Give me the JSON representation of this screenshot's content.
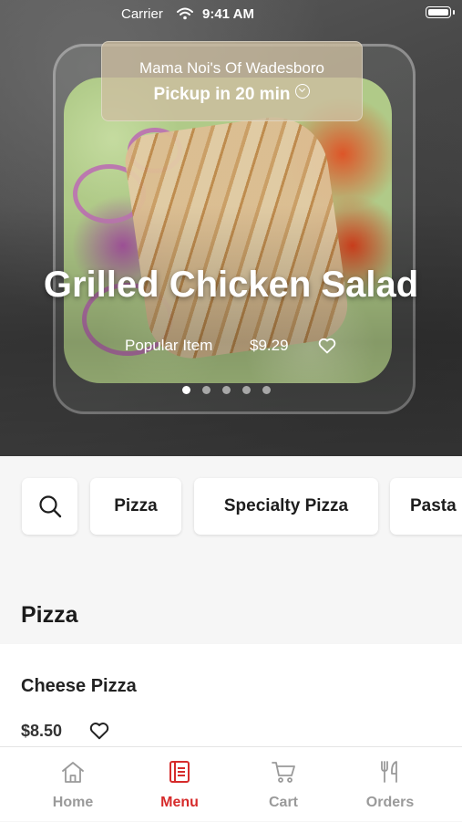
{
  "status_bar": {
    "carrier": "Carrier",
    "time": "9:41 AM"
  },
  "pickup": {
    "restaurant": "Mama Noi's Of Wadesboro",
    "mode": "Pickup in 20 min"
  },
  "hero": {
    "title": "Grilled Chicken Salad",
    "tag": "Popular Item",
    "price": "$9.29",
    "carousel_pages": 5,
    "carousel_active": 1
  },
  "categories": {
    "search_icon": "search-icon",
    "items": [
      "Pizza",
      "Specialty Pizza",
      "Pasta"
    ]
  },
  "section": {
    "title": "Pizza",
    "items": [
      {
        "name": "Cheese Pizza",
        "price": "$8.50"
      }
    ]
  },
  "tabs": {
    "items": [
      {
        "label": "Home",
        "icon": "home-icon"
      },
      {
        "label": "Menu",
        "icon": "menu-icon"
      },
      {
        "label": "Cart",
        "icon": "cart-icon"
      },
      {
        "label": "Orders",
        "icon": "orders-icon"
      }
    ],
    "active": "Menu"
  },
  "colors": {
    "accent": "#d62b2b",
    "inactive": "#9a9a9a"
  }
}
